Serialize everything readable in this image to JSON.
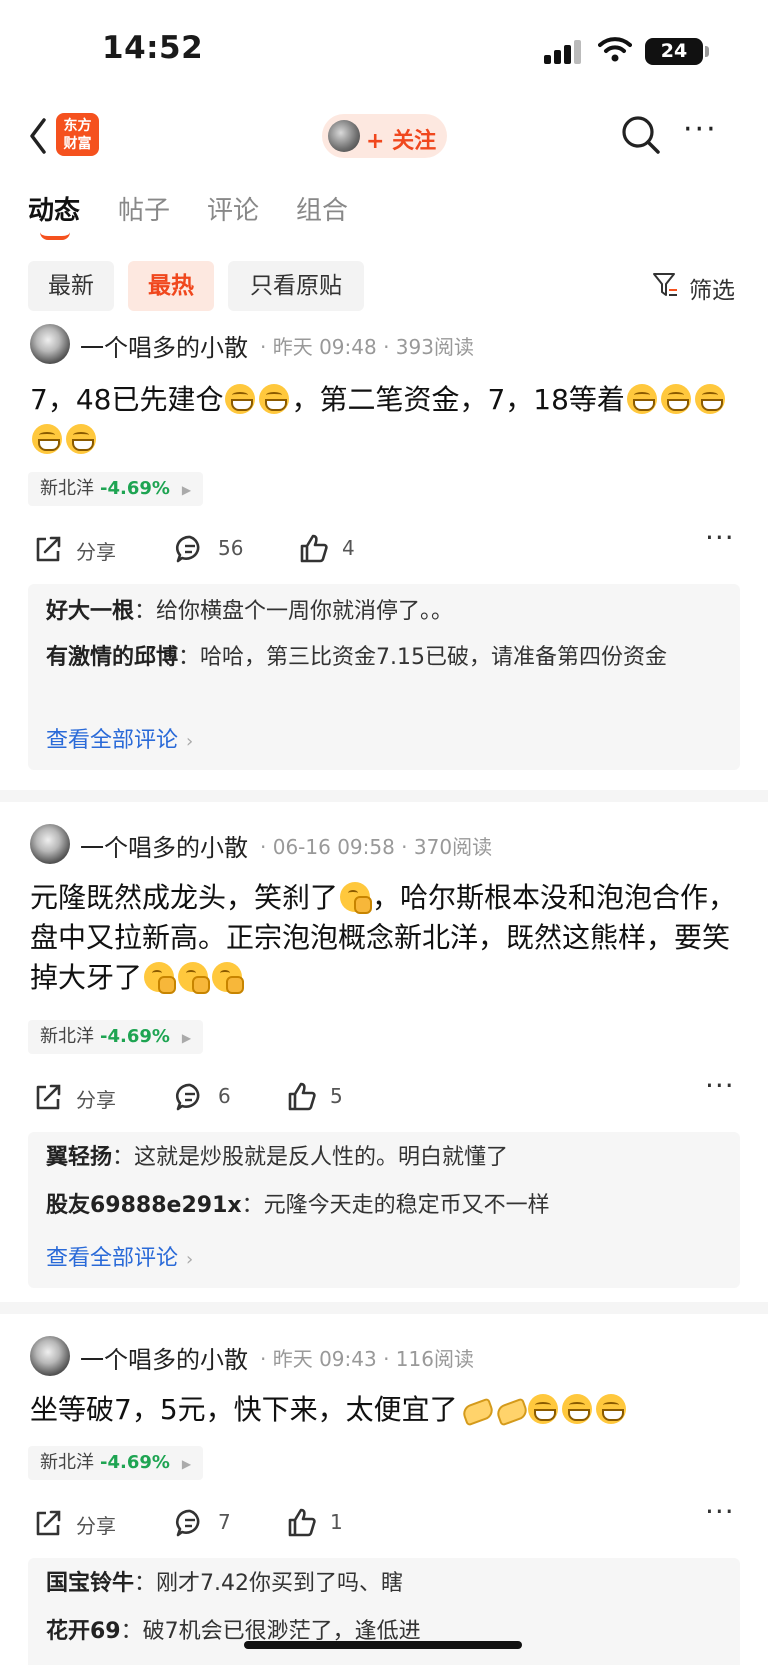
{
  "status": {
    "time": "14:52",
    "battery": "24"
  },
  "header": {
    "logo_line1": "东方",
    "logo_line2": "财富",
    "follow_label": "+ 关注",
    "icons": [
      "back-icon",
      "search-icon",
      "more-icon"
    ]
  },
  "tabs": [
    "动态",
    "帖子",
    "评论",
    "组合"
  ],
  "filters": {
    "chips": [
      "最新",
      "最热",
      "只看原贴"
    ],
    "active": "最热",
    "filter_label": "筛选"
  },
  "posts": [
    {
      "author": "一个唱多的小散",
      "time": "昨天 09:48",
      "reads": "393阅读",
      "text_a": "7，48已先建仓",
      "text_b": "，第二笔资金，7，18等着",
      "emojis": [
        "grin"
      ],
      "stock": {
        "name": "新北洋",
        "change": "-4.69%"
      },
      "share_label": "分享",
      "comment_count": "56",
      "like_count": "4",
      "comments": [
        {
          "user": "好大一根",
          "text": "给你横盘个一周你就消停了。。"
        },
        {
          "user": "有激情的邱博",
          "text": "哈哈，第三比资金7.15已破，请准备第四份资金"
        }
      ],
      "view_all": "查看全部评论"
    },
    {
      "author": "一个唱多的小散",
      "time": "06-16 09:58",
      "reads": "370阅读",
      "text_a": "元隆既然成龙头，笑刹了",
      "text_b": "，哈尔斯根本没和泡泡合作，盘中又拉新高。正宗泡泡概念新北洋，既然这熊样，要笑掉大牙了",
      "emojis": [
        "hand"
      ],
      "stock": {
        "name": "新北洋",
        "change": "-4.69%"
      },
      "share_label": "分享",
      "comment_count": "6",
      "like_count": "5",
      "comments": [
        {
          "user": "翼轻扬",
          "text": "这就是炒股就是反人性的。明白就懂了"
        },
        {
          "user": "股友69888e291x",
          "text": "元隆今天走的稳定币又不一样"
        }
      ],
      "view_all": "查看全部评论"
    },
    {
      "author": "一个唱多的小散",
      "time": "昨天 09:43",
      "reads": "116阅读",
      "text_a": "坐等破7，5元，快下来，太便宜了",
      "text_b": "",
      "emojis": [
        "clap",
        "grin"
      ],
      "stock": {
        "name": "新北洋",
        "change": "-4.69%"
      },
      "share_label": "分享",
      "comment_count": "7",
      "like_count": "1",
      "comments": [
        {
          "user": "国宝铃牛",
          "text": "刚才7.42你买到了吗、瞎"
        },
        {
          "user": "花开69",
          "text": "破7机会已很渺茫了，逢低进"
        }
      ]
    }
  ],
  "colors": {
    "brand": "#f5511e",
    "link": "#2a6ad8",
    "down": "#1ea452"
  }
}
